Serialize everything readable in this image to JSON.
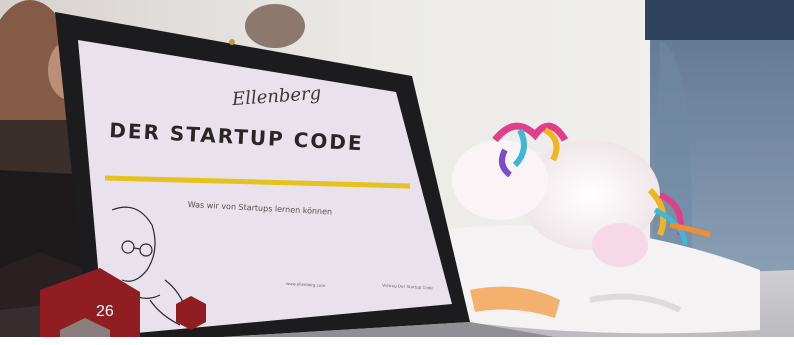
{
  "slide": {
    "signature": "Ellenberg",
    "title": "DER STARTUP CODE",
    "subtitle": "Was wir von Startups lernen können",
    "footer_left": "www.ellenberg.com",
    "footer_right": "Vortrag Der Startup Code"
  },
  "overlay": {
    "page_number": "26"
  },
  "colors": {
    "accent_yellow": "#e6c21c",
    "slide_bg": "#e9e2ec",
    "overlay_red": "#8f1d22"
  }
}
